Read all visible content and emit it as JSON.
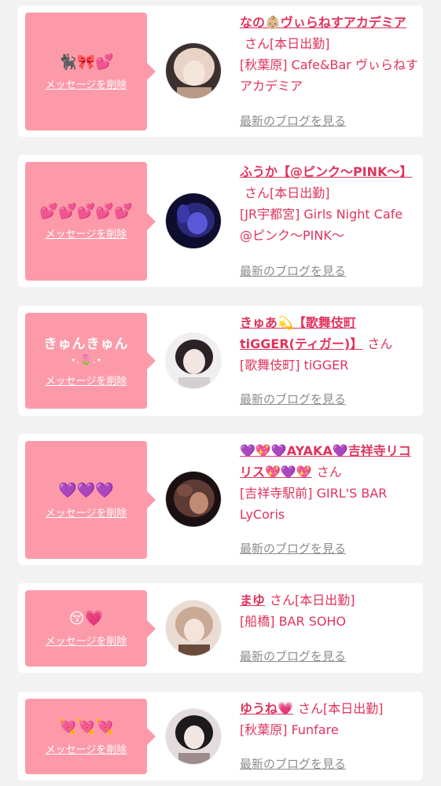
{
  "cards": [
    {
      "message": "🐈‍⬛🎀💕",
      "message2": "",
      "delete_label": "メッセージを削除",
      "name": "なの👶🏼ヴぃらねすアカデミア",
      "san": "さん",
      "badge": "[本日出勤]",
      "shop": "[秋葉原] Cafe&Bar ヴぃらねすアカデミア",
      "blog_label": "最新のブログを見る",
      "avatar_colors": [
        "#e9d3c6",
        "#b99a86",
        "#3b3030"
      ]
    },
    {
      "message": "💕💕💕💕💕",
      "message2": "",
      "delete_label": "メッセージを削除",
      "name": "ふうか【@ピンク〜PINK〜】",
      "san": "さん",
      "badge": "[本日出勤]",
      "shop": "[JR宇都宮] Girls Night Cafe @ピンク〜PINK〜",
      "blog_label": "最新のブログを見る",
      "avatar_colors": [
        "#5a58d6",
        "#2b2a7a",
        "#0e0d2e"
      ]
    },
    {
      "message": "きゅんきゅん",
      "message2": "⋆.🌷.⋆",
      "delete_label": "メッセージを削除",
      "name": "きゅあ💫【歌舞伎町tiGGER(ティガー)】",
      "san": "さん",
      "badge": "",
      "shop": "[歌舞伎町] tiGGER",
      "blog_label": "最新のブログを見る",
      "avatar_colors": [
        "#f0eeee",
        "#d6cfd0",
        "#2a2226"
      ]
    },
    {
      "message": "💜💜💜",
      "message2": "",
      "delete_label": "メッセージを削除",
      "name": "💜💖💜AYAKA💜吉祥寺リコリス💖💜💖",
      "san": "さん",
      "badge": "",
      "shop": "[吉祥寺駅前] GIRL'S BAR LyCoris",
      "blog_label": "最新のブログを見る",
      "avatar_colors": [
        "#c08a74",
        "#5d3a33",
        "#1a1012"
      ]
    },
    {
      "message": "😚💗",
      "message2": "",
      "delete_label": "メッセージを削除",
      "name": "まゆ",
      "san": "さん",
      "badge": "[本日出勤]",
      "shop": "[船橋] BAR SOHO",
      "blog_label": "最新のブログを見る",
      "avatar_colors": [
        "#eadcd2",
        "#c9aa94",
        "#6a4a3a"
      ]
    },
    {
      "message": "💘💘💘",
      "message2": "",
      "delete_label": "メッセージを削除",
      "name": "ゆうね💗",
      "san": "さん",
      "badge": "[本日出勤]",
      "shop": "[秋葉原] Funfare",
      "blog_label": "最新のブログを見る",
      "avatar_colors": [
        "#e4dcdc",
        "#9e8c8c",
        "#1d1a1c"
      ]
    }
  ]
}
